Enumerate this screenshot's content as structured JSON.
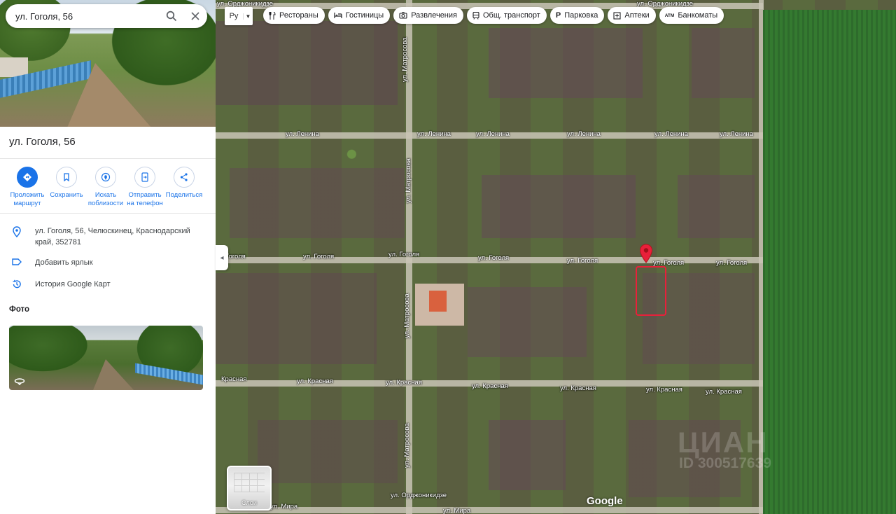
{
  "search": {
    "query": "ул. Гоголя, 56"
  },
  "place": {
    "title": "ул. Гоголя, 56"
  },
  "actions": [
    {
      "label": "Проложить маршрут",
      "icon": "directions-icon"
    },
    {
      "label": "Сохранить",
      "icon": "bookmark-icon"
    },
    {
      "label": "Искать поблизости",
      "icon": "nearby-icon"
    },
    {
      "label": "Отправить на телефон",
      "icon": "send-to-phone-icon"
    },
    {
      "label": "Поделиться",
      "icon": "share-icon"
    }
  ],
  "info": {
    "address": "ул. Гоголя, 56, Челюскинец, Краснодарский край, 352781",
    "add_label": "Добавить ярлык",
    "history": "История Google Карт"
  },
  "photos": {
    "title": "Фото"
  },
  "map": {
    "type_label": "Ру",
    "chips": [
      {
        "label": "Рестораны",
        "icon": "restaurant-icon"
      },
      {
        "label": "Гостиницы",
        "icon": "hotel-icon"
      },
      {
        "label": "Развлечения",
        "icon": "camera-icon"
      },
      {
        "label": "Общ. транспорт",
        "icon": "transit-icon"
      },
      {
        "label": "Парковка",
        "icon": "parking-icon"
      },
      {
        "label": "Аптеки",
        "icon": "pharmacy-icon"
      },
      {
        "label": "Банкоматы",
        "icon": "atm-icon"
      }
    ],
    "roads": {
      "lenina": "ул. Ленина",
      "gogolya": "ул. Гоголя",
      "gogolya_short": "Гоголя",
      "krasnaya": "ул. Красная",
      "krasnaya_short": "Красная",
      "matrosova": "ул. Матросова",
      "ordzhonikidze": "ул. Орджоникидзе",
      "mira": "ул. Мира"
    },
    "layers_label": "Слои",
    "google": "Google",
    "watermark_top": "ЦИАН",
    "watermark_id": "ID 300517639"
  },
  "colors": {
    "accent": "#1a73e8",
    "pin": "#e8203a"
  }
}
